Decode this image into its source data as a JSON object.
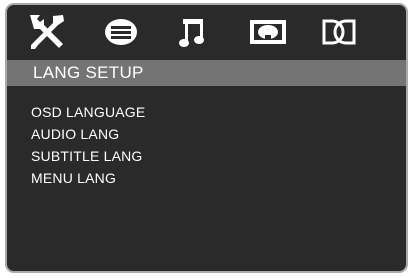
{
  "tabs": [
    {
      "icon": "general-setup-wrench-screwdriver-icon",
      "selected": false
    },
    {
      "icon": "language-setup-icon",
      "selected": true
    },
    {
      "icon": "audio-setup-music-note-icon",
      "selected": false
    },
    {
      "icon": "video-setup-icon",
      "selected": false
    },
    {
      "icon": "speaker-setup-dolby-icon",
      "selected": false
    }
  ],
  "header": {
    "title": "LANG SETUP"
  },
  "menu": {
    "items": [
      {
        "label": "OSD LANGUAGE"
      },
      {
        "label": "AUDIO LANG"
      },
      {
        "label": "SUBTITLE LANG"
      },
      {
        "label": "MENU LANG"
      }
    ]
  },
  "colors": {
    "background": "#2a2a2a",
    "header_bar": "#747474",
    "frame_border": "#a9a9a9",
    "text": "#ffffff"
  }
}
